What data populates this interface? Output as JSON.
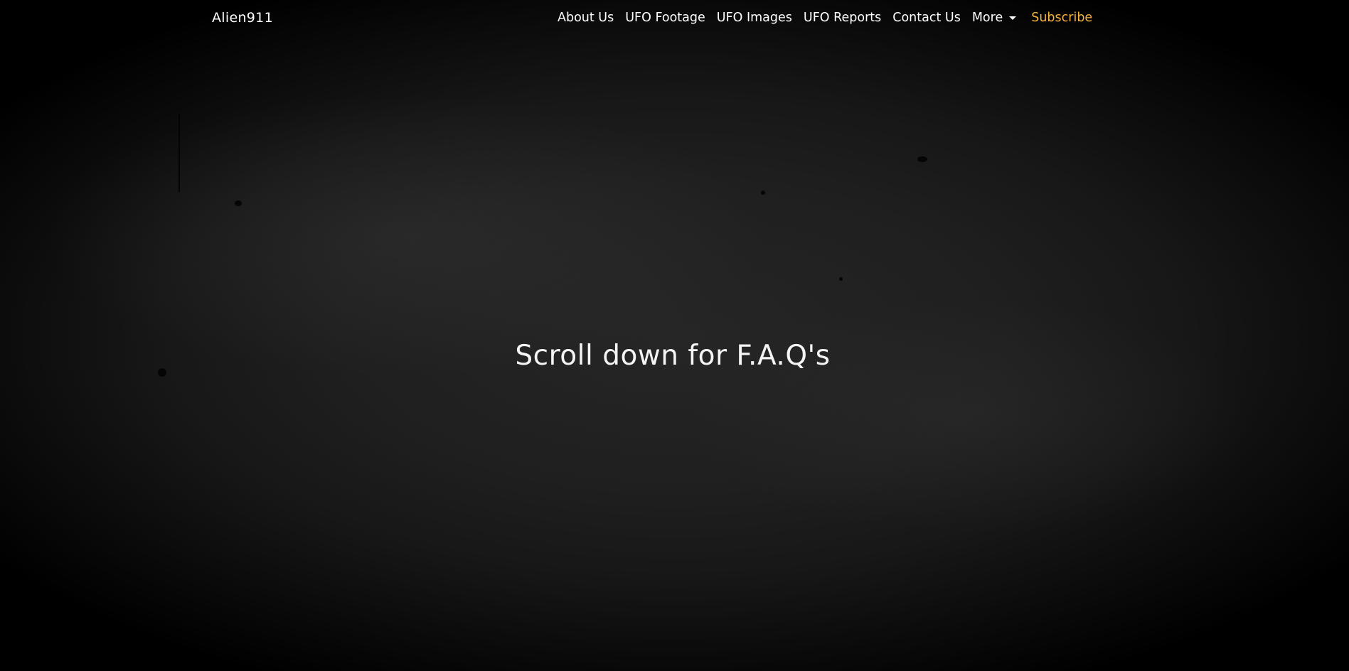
{
  "brand": {
    "name": "Alien911"
  },
  "nav": {
    "items": [
      {
        "label": "About Us"
      },
      {
        "label": "UFO Footage"
      },
      {
        "label": "UFO Images"
      },
      {
        "label": "UFO Reports"
      },
      {
        "label": "Contact Us"
      },
      {
        "label": "More"
      }
    ],
    "subscribe_label": "Subscribe"
  },
  "hero": {
    "headline": "Scroll down for F.A.Q's"
  },
  "colors": {
    "accent": "#f5b342",
    "text": "#ffffff",
    "background": "#000000"
  },
  "icons": {
    "dropdown": "caret-down-icon"
  }
}
